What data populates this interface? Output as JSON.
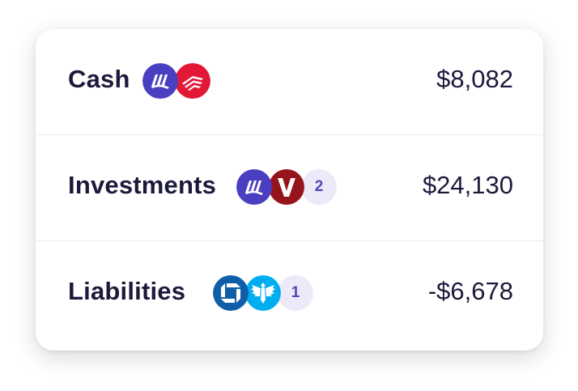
{
  "accounts": [
    {
      "label": "Cash",
      "amount": "$8,082",
      "logos": [
        "wealthfront-logo",
        "bank-of-america-logo"
      ]
    },
    {
      "label": "Investments",
      "amount": "$24,130",
      "logos": [
        "wealthfront-logo",
        "vanguard-logo"
      ],
      "extra_count": "2"
    },
    {
      "label": "Liabilities",
      "amount": "-$6,678",
      "logos": [
        "chase-logo",
        "barclays-logo"
      ],
      "extra_count": "1"
    }
  ],
  "brand_colors": {
    "wealthfront": "#4a3fc1",
    "bank_of_america": "#e31837",
    "vanguard": "#96151d",
    "chase": "#0f5fa8",
    "barclays": "#00aeef",
    "count_badge_bg": "#eceaf8",
    "count_badge_text": "#5047b8",
    "text": "#1c1a3b"
  }
}
